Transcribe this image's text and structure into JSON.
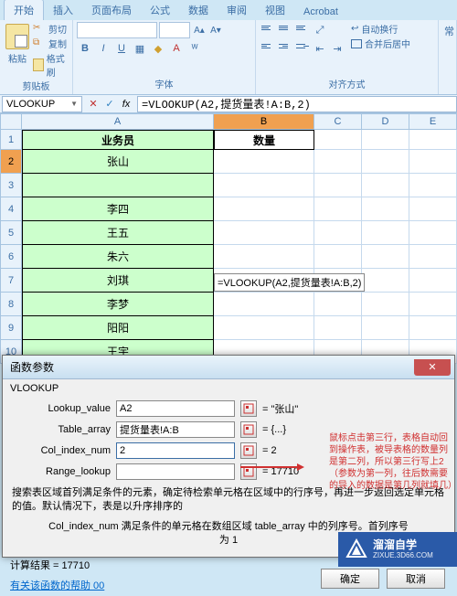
{
  "ribbon": {
    "tabs": [
      "开始",
      "插入",
      "页面布局",
      "公式",
      "数据",
      "审阅",
      "视图",
      "Acrobat"
    ],
    "active_tab": "开始",
    "clipboard": {
      "paste": "粘贴",
      "cut": "剪切",
      "copy": "复制",
      "format_painter": "格式刷",
      "label": "剪贴板"
    },
    "font": {
      "label": "字体",
      "bold": "B",
      "italic": "I",
      "underline": "U"
    },
    "align": {
      "label": "对齐方式",
      "wrap": "自动换行",
      "merge": "合并后居中"
    },
    "常": "常"
  },
  "namebox": "VLOOKUP",
  "formula_bar": "=VLOOKUP(A2,提货量表!A:B,2)",
  "columns": [
    "A",
    "B",
    "C",
    "D",
    "E"
  ],
  "header_row": {
    "A": "业务员",
    "B": "数量"
  },
  "cell_b2_display": "=VLOOKUP(A2,提货量表!A:B,2)",
  "rows": [
    "张山",
    "",
    "李四",
    "王五",
    "朱六",
    "刘琪",
    "李梦",
    "阳阳",
    "王宇"
  ],
  "dialog": {
    "title": "函数参数",
    "func": "VLOOKUP",
    "args": {
      "lookup_value": {
        "label": "Lookup_value",
        "value": "A2",
        "eval": "= \"张山\""
      },
      "table_array": {
        "label": "Table_array",
        "value": "提货量表!A:B",
        "eval": "= {...}"
      },
      "col_index_num": {
        "label": "Col_index_num",
        "value": "2",
        "eval": "= 2"
      },
      "range_lookup": {
        "label": "Range_lookup",
        "value": "",
        "eval": "= 17710"
      }
    },
    "red_hint": "鼠标点击第三行，表格自动回到操作表，被导表格的数量列是第二列，所以第三行写上2（参数为第一列，往后数需要的导入的数据是第几列就填几）",
    "desc1": "搜索表区域首列满足条件的元素，确定待检索单元格在区域中的行序号，再进一步返回选定单元格的值。默认情况下，表是以升序排序的",
    "desc2": "Col_index_num  满足条件的单元格在数组区域 table_array 中的列序号。首列序号为 1",
    "result_label": "计算结果 = ",
    "result_value": "17710",
    "help": "有关该函数的帮助 00",
    "ok": "确定",
    "cancel": "取消"
  },
  "watermark": {
    "cn": "溜溜自学",
    "url": "ZIXUE.3D66.COM"
  }
}
